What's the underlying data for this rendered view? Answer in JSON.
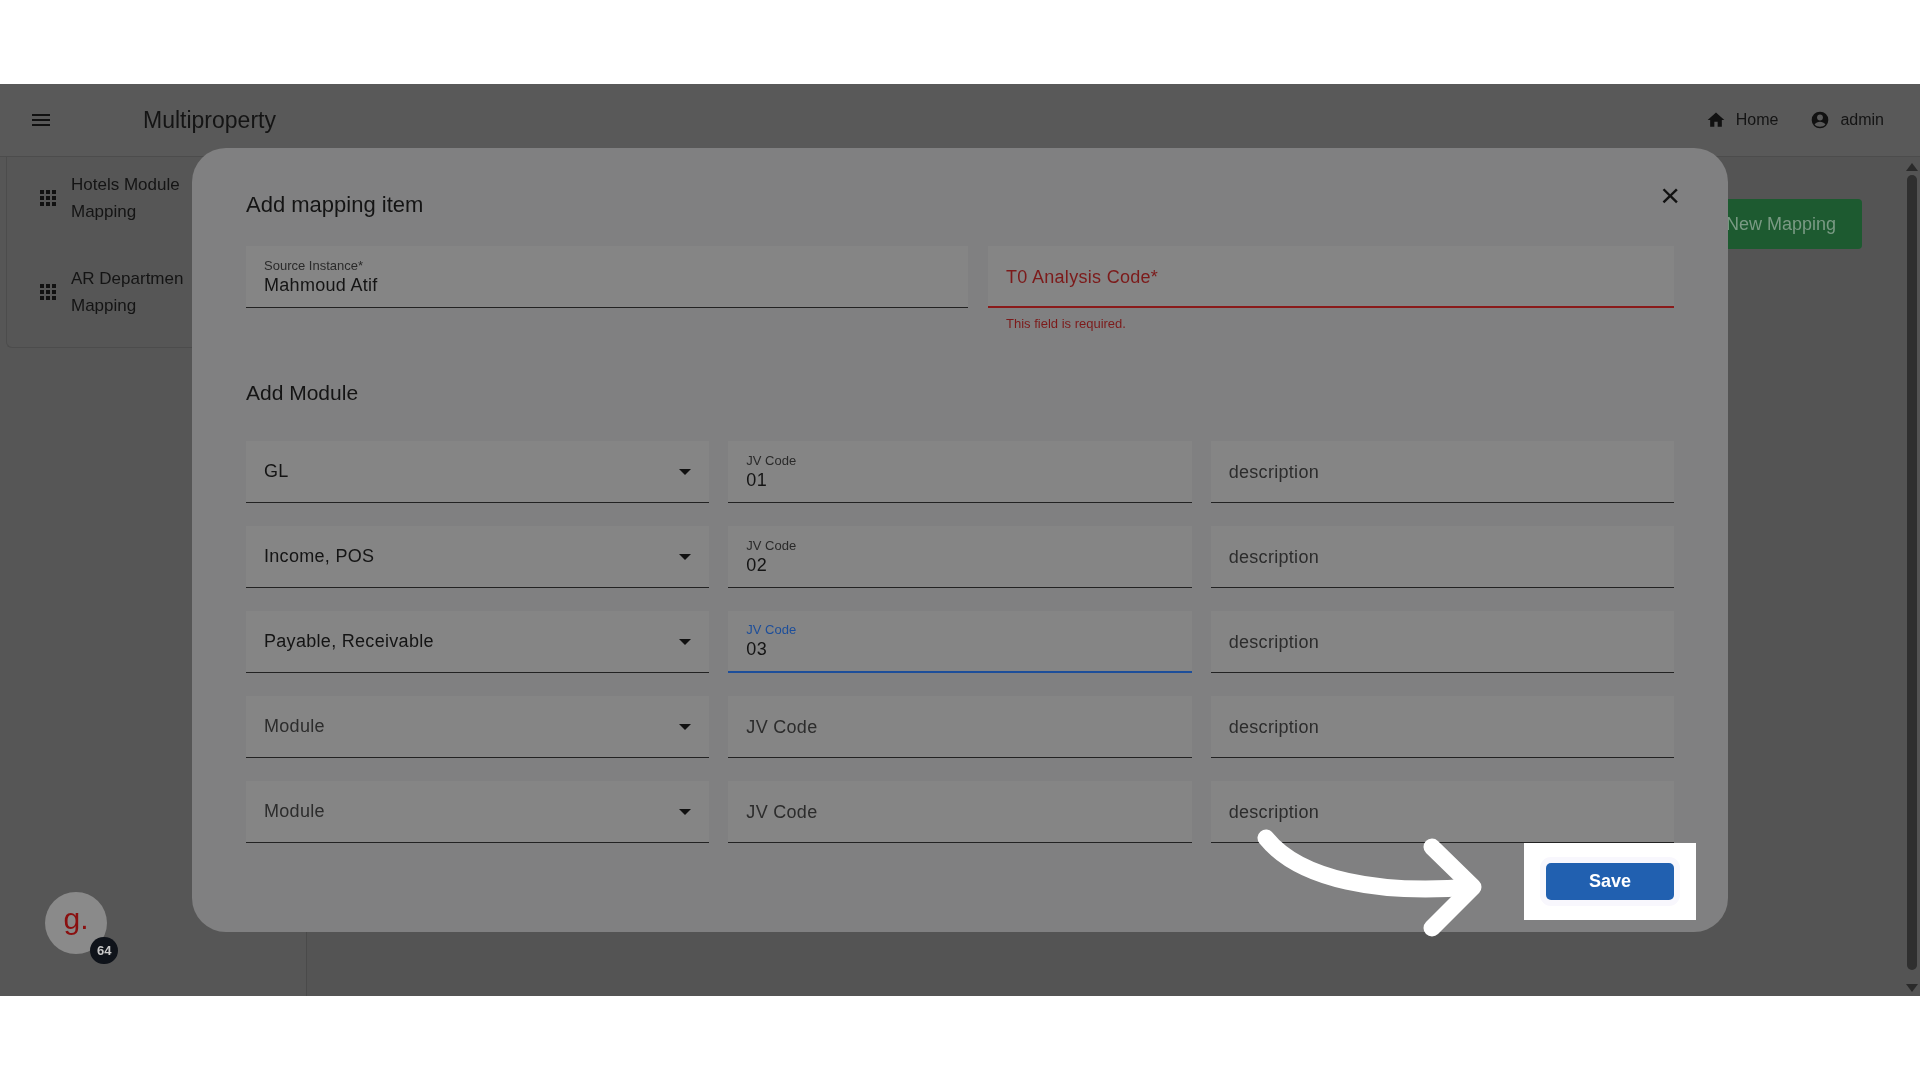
{
  "app_bar": {
    "title": "Multiproperty",
    "links": [
      {
        "label": "Home",
        "kind": "home"
      },
      {
        "label": "admin",
        "kind": "account"
      }
    ]
  },
  "sidebar": {
    "items": [
      {
        "lines": [
          "Hotels Module",
          "Mapping"
        ]
      },
      {
        "lines": [
          "AR Departmen",
          "Mapping"
        ]
      }
    ],
    "avatar": {
      "letter": "g.",
      "badge": "64"
    }
  },
  "page": {
    "new_button": "New Mapping"
  },
  "dialog": {
    "title": "Add mapping item",
    "close": "×",
    "source": {
      "label": "Source Instance*",
      "value": "Mahmoud Atif"
    },
    "analysis_code": {
      "placeholder": "T0 Analysis Code*",
      "invalid": true,
      "error": "This field is required."
    },
    "section_title": "Add Module",
    "rows": [
      {
        "module": {
          "value": "GL"
        },
        "jv_code": {
          "label": "JV Code",
          "value": "01",
          "focused": false
        },
        "description": {
          "placeholder": "description"
        }
      },
      {
        "module": {
          "value": "Income, POS"
        },
        "jv_code": {
          "label": "JV Code",
          "value": "02",
          "focused": false
        },
        "description": {
          "placeholder": "description"
        }
      },
      {
        "module": {
          "value": "Payable, Receivable"
        },
        "jv_code": {
          "label": "JV Code",
          "value": "03",
          "focused": true
        },
        "description": {
          "placeholder": "description"
        }
      },
      {
        "module": {
          "placeholder": "Module"
        },
        "jv_code": {
          "placeholder": "JV Code",
          "focused": false
        },
        "description": {
          "placeholder": "description"
        }
      },
      {
        "module": {
          "placeholder": "Module"
        },
        "jv_code": {
          "placeholder": "JV Code",
          "focused": false
        },
        "description": {
          "placeholder": "description"
        }
      }
    ],
    "save": "Save"
  }
}
